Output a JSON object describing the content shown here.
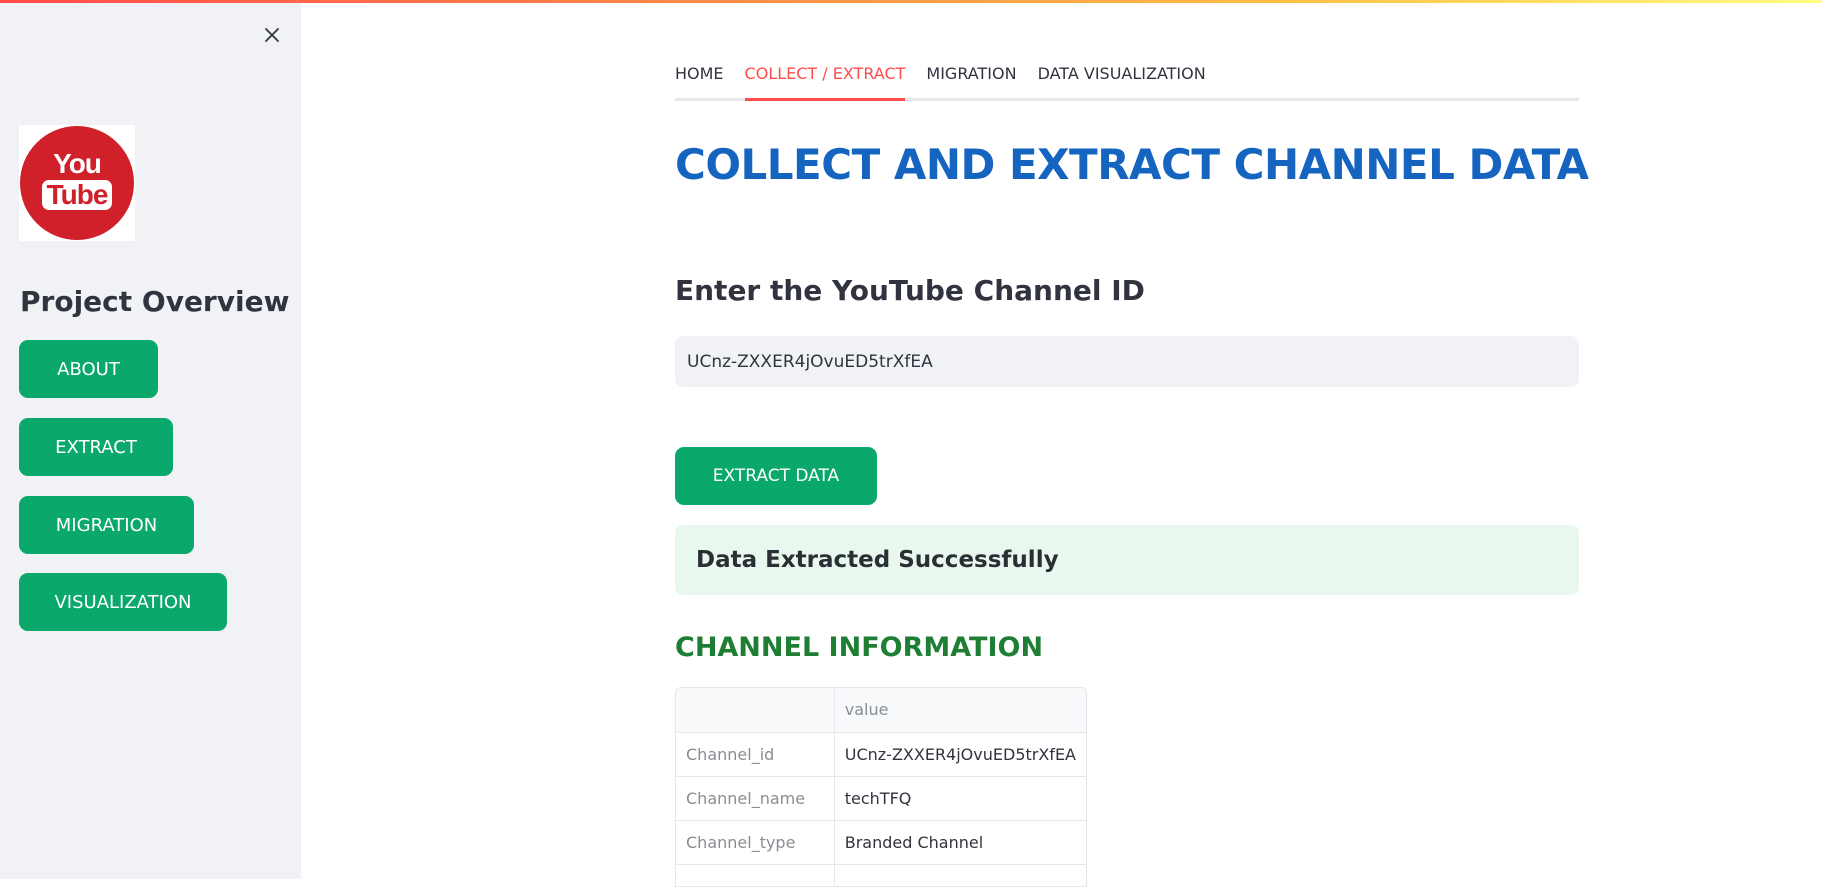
{
  "sidebar": {
    "close_glyph": "×",
    "logo": {
      "line1": "You",
      "line2": "Tube"
    },
    "title": "Project Overview",
    "buttons": [
      "ABOUT",
      "EXTRACT",
      "MIGRATION",
      "VISUALIZATION"
    ]
  },
  "tabs": [
    {
      "label": "HOME",
      "active": false
    },
    {
      "label": "COLLECT / EXTRACT",
      "active": true
    },
    {
      "label": "MIGRATION",
      "active": false
    },
    {
      "label": "DATA VISUALIZATION",
      "active": false
    }
  ],
  "main": {
    "title": "COLLECT AND EXTRACT CHANNEL DATA",
    "input_label": "Enter the YouTube Channel ID",
    "input_value": "UCnz-ZXXER4jOvuED5trXfEA",
    "extract_button": "EXTRACT DATA",
    "success_message": "Data Extracted Successfully",
    "channel_heading": "CHANNEL INFORMATION",
    "table": {
      "header": [
        "",
        "value"
      ],
      "rows": [
        [
          "Channel_id",
          "UCnz-ZXXER4jOvuED5trXfEA"
        ],
        [
          "Channel_name",
          "techTFQ"
        ],
        [
          "Channel_type",
          "Branded Channel"
        ],
        [
          "",
          ""
        ]
      ]
    }
  },
  "colors": {
    "accent_red": "#ff4b4b",
    "button_green": "#0aa86a",
    "title_blue": "#1565c0",
    "heading_green": "#1e7e34",
    "success_bg": "#e8f8ee",
    "sidebar_bg": "#f0f2f6",
    "logo_red": "#d0202a"
  }
}
